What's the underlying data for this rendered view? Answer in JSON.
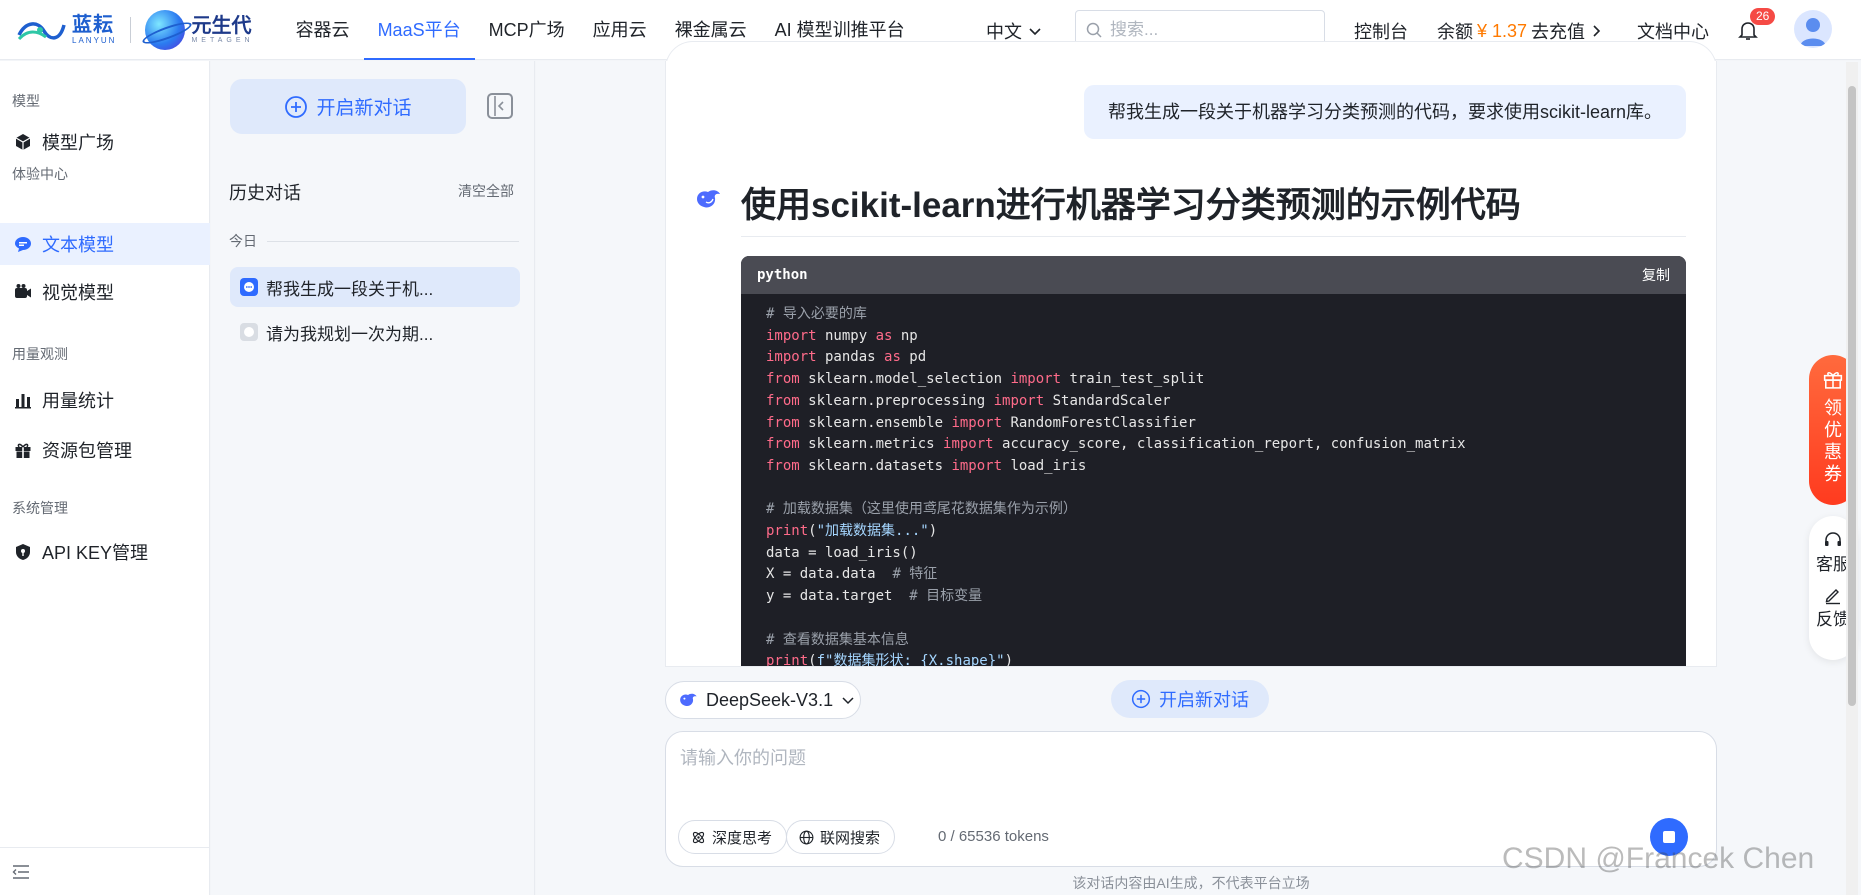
{
  "header": {
    "brand1_cn": "蓝耘",
    "brand1_en": "LANYUN",
    "brand2_cn": "元生代",
    "brand2_en": "METAGEN",
    "nav": [
      {
        "label": "容器云",
        "active": false
      },
      {
        "label": "MaaS平台",
        "active": true
      },
      {
        "label": "MCP广场",
        "active": false
      },
      {
        "label": "应用云",
        "active": false
      },
      {
        "label": "裸金属云",
        "active": false
      },
      {
        "label": "AI 模型训推平台",
        "active": false
      }
    ],
    "language": "中文",
    "search_placeholder": "搜索...",
    "console": "控制台",
    "balance_label": "余额",
    "balance_value": "¥ 1.37",
    "recharge": "去充值",
    "docs": "文档中心",
    "notifications": "26"
  },
  "sidebar": {
    "groups": [
      {
        "title": "模型",
        "items": [
          {
            "label": "模型广场",
            "icon": "cube-icon",
            "active": false
          }
        ]
      },
      {
        "title": "体验中心",
        "items": [
          {
            "label": "文本模型",
            "icon": "chat-bubble-icon",
            "active": true
          },
          {
            "label": "视觉模型",
            "icon": "camera-icon",
            "active": false
          }
        ]
      },
      {
        "title": "用量观测",
        "items": [
          {
            "label": "用量统计",
            "icon": "bar-chart-icon",
            "active": false
          },
          {
            "label": "资源包管理",
            "icon": "gift-icon",
            "active": false
          }
        ]
      },
      {
        "title": "系统管理",
        "items": [
          {
            "label": "API KEY管理",
            "icon": "shield-key-icon",
            "active": false
          }
        ]
      }
    ]
  },
  "history": {
    "new_chat": "开启新对话",
    "title": "历史对话",
    "clear_all": "清空全部",
    "today": "今日",
    "items": [
      {
        "label": "帮我生成一段关于机...",
        "active": true
      },
      {
        "label": "请为我规划一次为期...",
        "active": false
      }
    ]
  },
  "conversation": {
    "user_message": "帮我生成一段关于机器学习分类预测的代码，要求使用scikit-learn库。",
    "answer_title": "使用scikit-learn进行机器学习分类预测的示例代码",
    "code_lang": "python",
    "copy_label": "复制",
    "code": {
      "c1": "# 导入必要的库",
      "l1_kw": "import",
      "l1_a": " numpy ",
      "l1_kw2": "as",
      "l1_b": " np",
      "l2_kw": "import",
      "l2_a": " pandas ",
      "l2_kw2": "as",
      "l2_b": " pd",
      "l3_kw": "from",
      "l3_a": " sklearn.model_selection ",
      "l3_kw2": "import",
      "l3_b": " train_test_split",
      "l4_kw": "from",
      "l4_a": " sklearn.preprocessing ",
      "l4_kw2": "import",
      "l4_b": " StandardScaler",
      "l5_kw": "from",
      "l5_a": " sklearn.ensemble ",
      "l5_kw2": "import",
      "l5_b": " RandomForestClassifier",
      "l6_kw": "from",
      "l6_a": " sklearn.metrics ",
      "l6_kw2": "import",
      "l6_b": " accuracy_score, classification_report, confusion_matrix",
      "l7_kw": "from",
      "l7_a": " sklearn.datasets ",
      "l7_kw2": "import",
      "l7_b": " load_iris",
      "c2": "# 加载数据集（这里使用鸢尾花数据集作为示例）",
      "p1_fn": "print",
      "p1_open": "(",
      "p1_str": "\"加载数据集...\"",
      "p1_close": ")",
      "l8": "data = load_iris()",
      "l9_a": "X = data.data  ",
      "l9_c": "# 特征",
      "l10_a": "y = data.target  ",
      "l10_c": "# 目标变量",
      "c3": "# 查看数据集基本信息",
      "p2_fn": "print",
      "p2_open": "(",
      "p2_str": "f\"数据集形状: {X.shape}\"",
      "p2_close": ")"
    }
  },
  "composer": {
    "model": "DeepSeek-V3.1",
    "new_chat": "开启新对话",
    "placeholder": "请输入你的问题",
    "deep_think": "深度思考",
    "web_search": "联网搜索",
    "tokens": "0 / 65536 tokens",
    "disclaimer": "该对话内容由AI生成，不代表平台立场"
  },
  "float": {
    "coupon": "领优惠券",
    "service": "客服",
    "feedback": "反馈"
  },
  "watermark": "CSDN @Francek Chen",
  "colors": {
    "accent": "#2f6bff",
    "balance": "#ff7a00",
    "coupon": "#ff4a24",
    "badge": "#f54a45"
  }
}
